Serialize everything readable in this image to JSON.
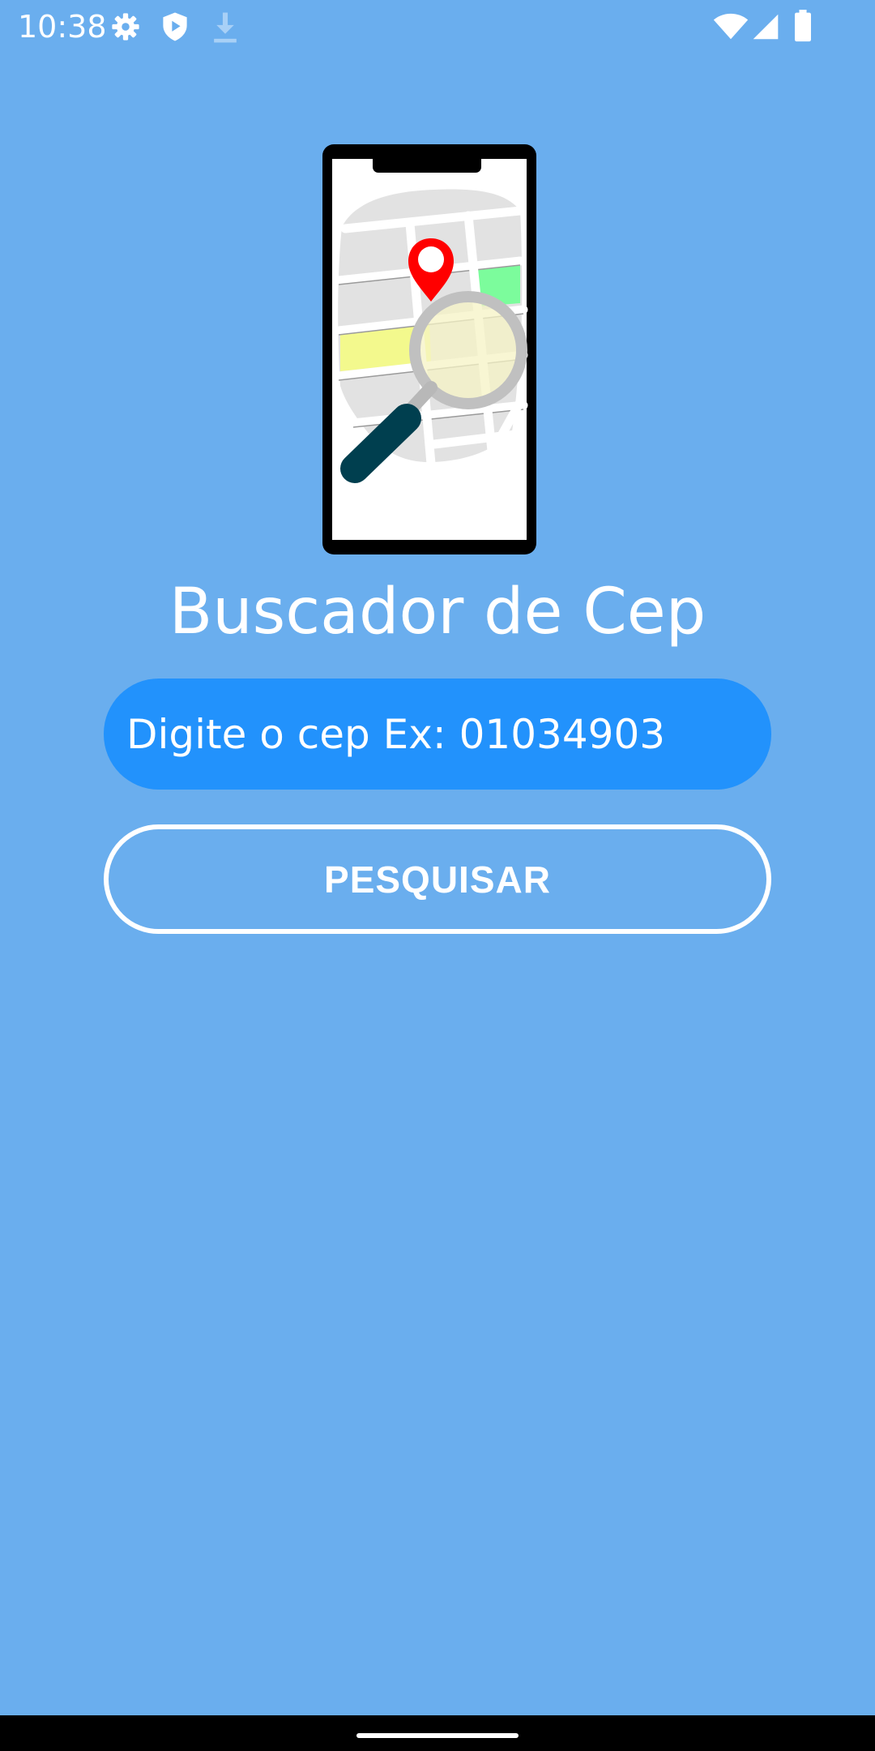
{
  "status_bar": {
    "time": "10:38",
    "icons_left": [
      "gear-icon",
      "play-protect-icon",
      "download-icon"
    ],
    "icons_right": [
      "wifi-icon",
      "cell-signal-icon",
      "battery-icon"
    ]
  },
  "illustration": {
    "icon": "phone-map-search-illustration",
    "colors": {
      "pin": "#ff0000",
      "green_block": "#7cfc9c",
      "yellow_block": "#f3f98d",
      "magnifier_handle": "#003f4f",
      "magnifier_rim": "#c0c0c0"
    }
  },
  "title": "Buscador de Cep",
  "cep_input": {
    "value": "",
    "placeholder": "Digite o cep Ex: 01034903"
  },
  "search_button": {
    "label": "PESQUISAR"
  },
  "colors": {
    "background": "#6aaeee",
    "input_background": "#2292fc",
    "text": "#ffffff"
  }
}
